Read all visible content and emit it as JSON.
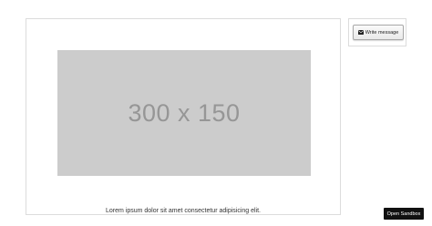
{
  "main": {
    "image": {
      "placeholder_text": "300 x 150",
      "background_color": "#cccccc",
      "text_color": "#969696"
    },
    "caption": "Lorem ipsum dolor sit amet consectetur adipisicing elit."
  },
  "sidebar": {
    "write_message_label": "Write message",
    "write_message_icon": "envelope-icon"
  },
  "footer": {
    "open_sandbox_label": "Open Sandbox"
  }
}
